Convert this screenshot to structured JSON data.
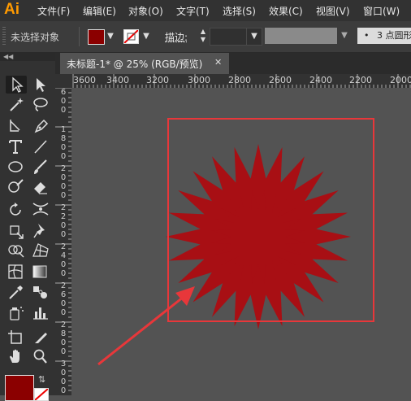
{
  "app": {
    "logo": "Ai"
  },
  "menu": [
    "文件(F)",
    "编辑(E)",
    "对象(O)",
    "文字(T)",
    "选择(S)",
    "效果(C)",
    "视图(V)",
    "窗口(W)"
  ],
  "control_bar": {
    "selection_status": "未选择对象",
    "fill_color": "#8b0000",
    "stroke_label": "描边:",
    "brush_preset": "3 点圆形"
  },
  "document": {
    "tab_title": "未标题-1* @ 25% (RGB/预览)",
    "close_glyph": "✕"
  },
  "rulers": {
    "horizontal": [
      "3600",
      "3400",
      "3200",
      "3000",
      "2800",
      "2600",
      "2400",
      "2200",
      "2000"
    ],
    "vertical": [
      "600",
      "1800",
      "2000",
      "2200",
      "2400",
      "2600",
      "2800",
      "3000"
    ]
  },
  "artwork": {
    "shape": "starburst",
    "fill_color": "#a80f14",
    "frame_color": "#e8373a",
    "arrow_color": "#e8373a"
  },
  "colors": {
    "menubar": "#323232",
    "panel": "#3c3c3c",
    "canvas": "#535353",
    "accent": "#ff9a00"
  }
}
